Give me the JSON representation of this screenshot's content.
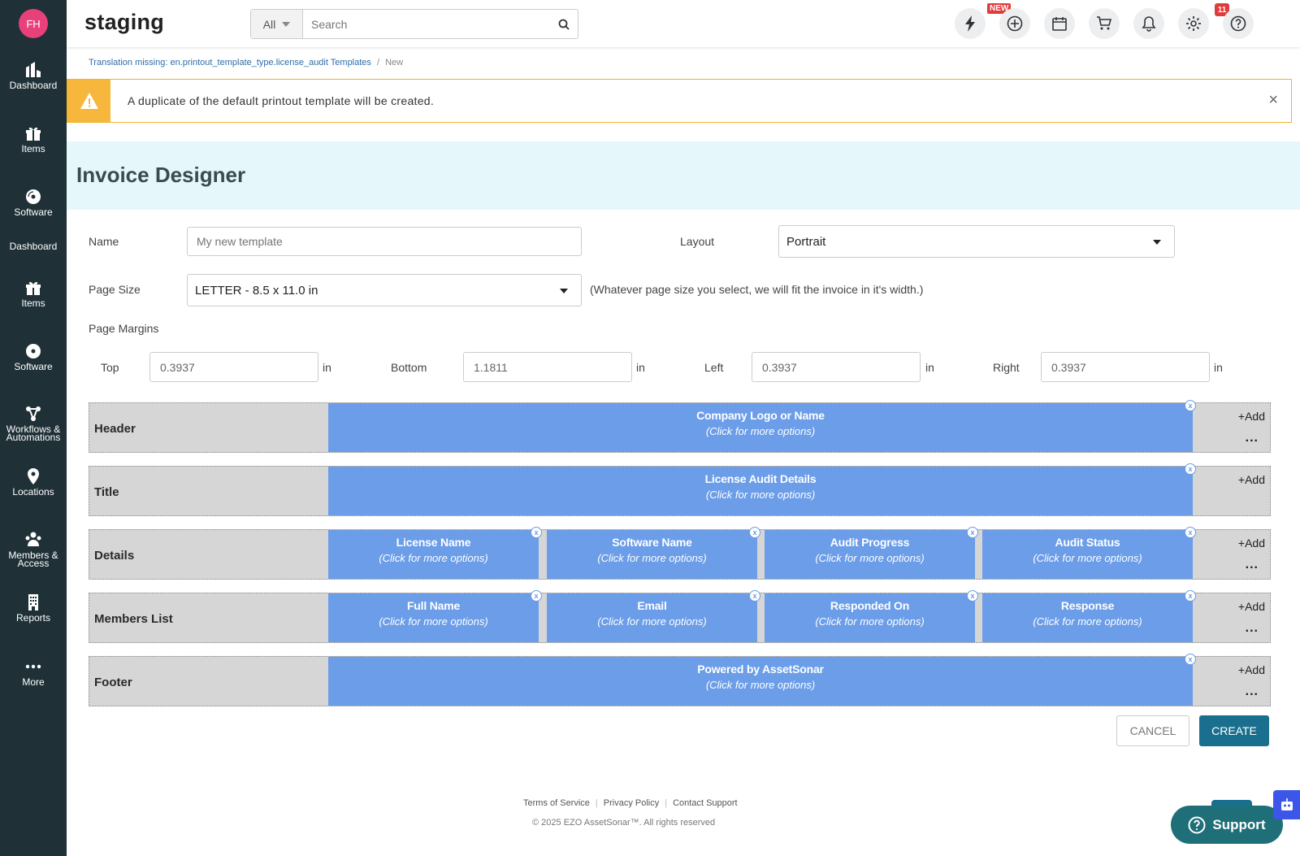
{
  "app": {
    "brand": "staging",
    "avatar_initials": "FH"
  },
  "sidebar": {
    "items": [
      {
        "label": "Dashboard",
        "icon": "dashboard-icon"
      },
      {
        "label": "Items",
        "icon": "gift-icon"
      },
      {
        "label": "Software",
        "icon": "disc-icon"
      },
      {
        "label": "Dashboard",
        "icon": ""
      },
      {
        "label": "Items",
        "icon": "gift-icon"
      },
      {
        "label": "Software",
        "icon": "disc-icon"
      },
      {
        "label": "Workflows &",
        "label2": "Automations",
        "icon": "workflow-icon"
      },
      {
        "label": "Locations",
        "icon": "map-pin-icon"
      },
      {
        "label": "Members &",
        "label2": "Access",
        "icon": "members-icon"
      },
      {
        "label": "Reports",
        "icon": "building-icon"
      },
      {
        "label": "More",
        "icon": "more-dots-icon"
      }
    ]
  },
  "search": {
    "scope": "All",
    "placeholder": "Search"
  },
  "topbar": {
    "new_badge": "NEW",
    "notification_count": "11"
  },
  "breadcrumb": {
    "link": "Translation missing: en.printout_template_type.license_audit Templates",
    "separator": "/",
    "current": "New"
  },
  "alert": {
    "message": "A duplicate of the default printout template will be created.",
    "close": "×"
  },
  "page": {
    "title": "Invoice Designer"
  },
  "form": {
    "name_label": "Name",
    "name_placeholder": "My new template",
    "layout_label": "Layout",
    "layout_value": "Portrait",
    "page_size_label": "Page Size",
    "page_size_value": "LETTER - 8.5 x 11.0 in",
    "page_size_hint": "(Whatever page size you select, we will fit the invoice in it's width.)",
    "margins_label": "Page Margins",
    "margins": {
      "top_label": "Top",
      "top_value": "0.3937",
      "bottom_label": "Bottom",
      "bottom_value": "1.1811",
      "left_label": "Left",
      "left_value": "0.3937",
      "right_label": "Right",
      "right_value": "0.3937",
      "unit": "in"
    }
  },
  "designer": {
    "option_hint": "(Click for more options)",
    "add_label": "+Add",
    "more_label": "...",
    "remove_label": "x",
    "rows": [
      {
        "label": "Header",
        "fields": [
          "Company Logo or Name"
        ],
        "has_more": true
      },
      {
        "label": "Title",
        "fields": [
          "License Audit Details"
        ],
        "has_more": false
      },
      {
        "label": "Details",
        "fields": [
          "License Name",
          "Software Name",
          "Audit Progress",
          "Audit Status"
        ],
        "has_more": true
      },
      {
        "label": "Members List",
        "fields": [
          "Full Name",
          "Email",
          "Responded On",
          "Response"
        ],
        "has_more": true
      },
      {
        "label": "Footer",
        "fields": [
          "Powered by AssetSonar"
        ],
        "has_more": true
      }
    ]
  },
  "actions": {
    "cancel": "CANCEL",
    "create": "CREATE"
  },
  "footer": {
    "terms": "Terms of Service",
    "privacy": "Privacy Policy",
    "contact": "Contact Support",
    "copyright": "© 2025 EZO AssetSonar™. All rights reserved"
  },
  "support": {
    "label": "Support"
  },
  "colors": {
    "sidebar": "#1f3137",
    "accent": "#1a6f8f",
    "field": "#6b9de8",
    "alert": "#f6b73c"
  }
}
